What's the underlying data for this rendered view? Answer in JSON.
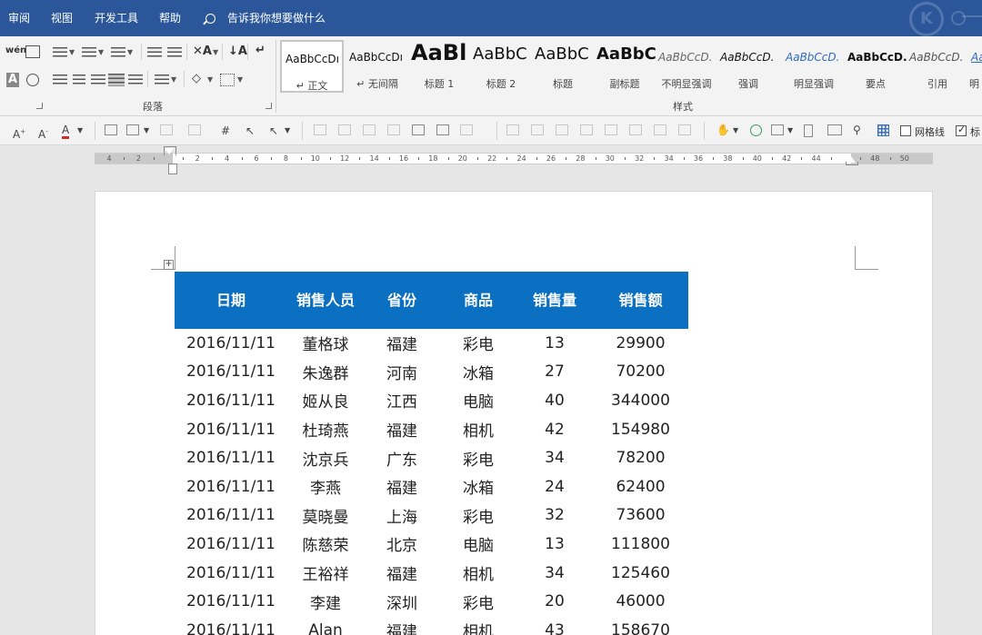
{
  "menu": {
    "items": [
      "审阅",
      "视图",
      "开发工具",
      "帮助"
    ],
    "search_text": "告诉我你想要做什么"
  },
  "ribbon": {
    "paragraph_group_label": "段落",
    "styles_group_label": "样式",
    "styles": [
      {
        "preview": "AaBbCcDı",
        "name": "↵ 正文",
        "selected": true
      },
      {
        "preview": "AaBbCcDı",
        "name": "↵ 无间隔"
      },
      {
        "preview": "AaBl",
        "name": "标题 1"
      },
      {
        "preview": "AaBbC",
        "name": "标题 2"
      },
      {
        "preview": "AaBbC",
        "name": "标题"
      },
      {
        "preview": "AaBbC",
        "name": "副标题"
      },
      {
        "preview": "AaBbCcD.",
        "name": "不明显强调"
      },
      {
        "preview": "AaBbCcD.",
        "name": "强调"
      },
      {
        "preview": "AaBbCcD.",
        "name": "明显强调"
      },
      {
        "preview": "AaBbCcD.",
        "name": "要点"
      },
      {
        "preview": "AaBbCcD.",
        "name": "引用"
      },
      {
        "preview": "Aa",
        "name": "明"
      }
    ]
  },
  "toolbar": {
    "gridlines_label": "网格线",
    "gridlines_checked": false,
    "ruler_label": "标",
    "ruler_checked": true
  },
  "ruler": {
    "labels": [
      "4",
      "2",
      "",
      "2",
      "4",
      "6",
      "8",
      "10",
      "12",
      "14",
      "16",
      "18",
      "20",
      "22",
      "24",
      "26",
      "28",
      "30",
      "32",
      "34",
      "36",
      "38",
      "40",
      "42",
      "44",
      "",
      "48",
      "50"
    ]
  },
  "table": {
    "header_color": "#0b6fc2",
    "columns": [
      "日期",
      "销售人员",
      "省份",
      "商品",
      "销售量",
      "销售额"
    ],
    "rows": [
      [
        "2016/11/11",
        "董格球",
        "福建",
        "彩电",
        "13",
        "29900"
      ],
      [
        "2016/11/11",
        "朱逸群",
        "河南",
        "冰箱",
        "27",
        "70200"
      ],
      [
        "2016/11/11",
        "姬从良",
        "江西",
        "电脑",
        "40",
        "344000"
      ],
      [
        "2016/11/11",
        "杜琦燕",
        "福建",
        "相机",
        "42",
        "154980"
      ],
      [
        "2016/11/11",
        "沈京兵",
        "广东",
        "彩电",
        "34",
        "78200"
      ],
      [
        "2016/11/11",
        "李燕",
        "福建",
        "冰箱",
        "24",
        "62400"
      ],
      [
        "2016/11/11",
        "莫晓曼",
        "上海",
        "彩电",
        "32",
        "73600"
      ],
      [
        "2016/11/11",
        "陈慈荣",
        "北京",
        "电脑",
        "13",
        "111800"
      ],
      [
        "2016/11/11",
        "王裕祥",
        "福建",
        "相机",
        "34",
        "125460"
      ],
      [
        "2016/11/11",
        "李建",
        "深圳",
        "彩电",
        "20",
        "46000"
      ],
      [
        "2016/11/11",
        "Alan",
        "福建",
        "相机",
        "43",
        "158670"
      ]
    ]
  }
}
